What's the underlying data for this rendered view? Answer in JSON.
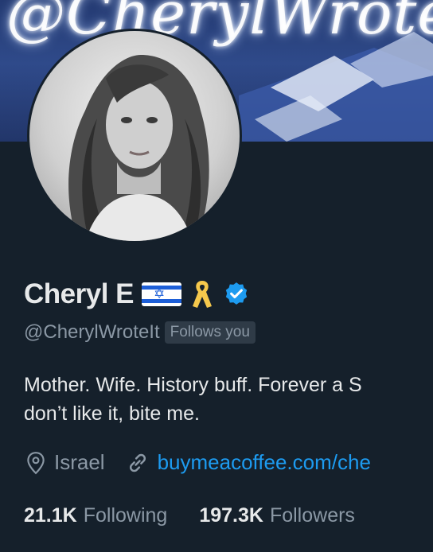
{
  "banner": {
    "text": "@CherylWrote"
  },
  "profile": {
    "name": "Cheryl E",
    "handle": "@CherylWroteIt",
    "follows_you": "Follows you",
    "bio_line1": "Mother. Wife. History buff. Forever a S",
    "bio_line2": "don’t like it, bite me.",
    "location": "Israel",
    "website": "buymeacoffee.com/che",
    "following_count": "21.1K",
    "following_label": "Following",
    "followers_count": "197.3K",
    "followers_label": "Followers"
  },
  "icons": [
    "israel-flag-icon",
    "yellow-ribbon-icon",
    "verified-badge-icon",
    "location-pin-icon",
    "link-icon"
  ],
  "colors": {
    "background": "#15202b",
    "accent": "#1d9bf0",
    "muted": "#8b98a5",
    "verified": "#1d9bf0",
    "ribbon": "#f5c84c"
  }
}
